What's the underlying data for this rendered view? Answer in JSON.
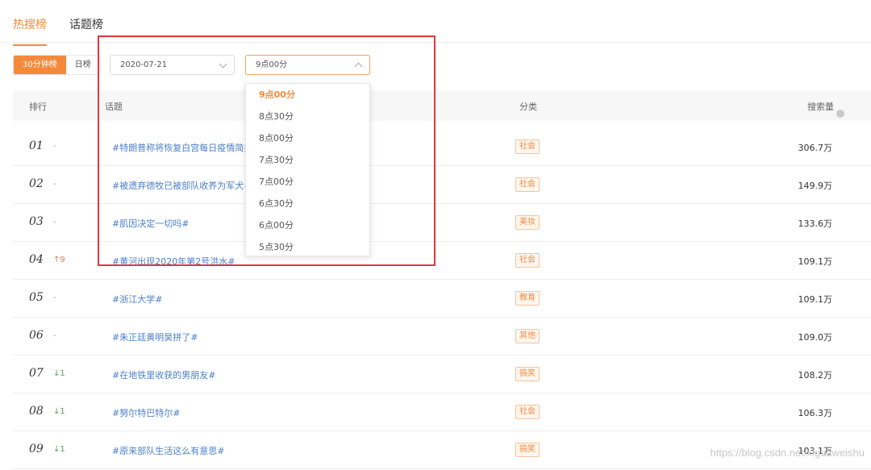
{
  "tabs": [
    {
      "label": "热搜榜",
      "active": true
    },
    {
      "label": "话题榜",
      "active": false
    }
  ],
  "filters": {
    "period_buttons": [
      {
        "label": "30分钟榜",
        "active": true
      },
      {
        "label": "日榜",
        "active": false
      }
    ],
    "date_value": "2020-07-21",
    "time_value": "9点00分"
  },
  "dropdown": {
    "options": [
      "9点00分",
      "8点30分",
      "8点00分",
      "7点30分",
      "7点00分",
      "6点30分",
      "6点00分",
      "5点30分"
    ],
    "selected": "9点00分"
  },
  "table": {
    "headers": {
      "rank": "排行",
      "topic": "话题",
      "category": "分类",
      "volume": "搜索量"
    },
    "rows": [
      {
        "rank": "01",
        "trend": "-",
        "trend_dir": "none",
        "topic": "#特朗普称将恢复白宫每日疫情简报#",
        "category": "社会",
        "volume": "306.7万"
      },
      {
        "rank": "02",
        "trend": "-",
        "trend_dir": "none",
        "topic": "#被遗弃德牧已被部队收养为军犬#",
        "category": "社会",
        "volume": "149.9万"
      },
      {
        "rank": "03",
        "trend": "-",
        "trend_dir": "none",
        "topic": "#肌因决定一切吗#",
        "category": "美妆",
        "volume": "133.6万"
      },
      {
        "rank": "04",
        "trend": "↑9",
        "trend_dir": "up",
        "topic": "#黄河出现2020年第2号洪水#",
        "category": "社会",
        "volume": "109.1万"
      },
      {
        "rank": "05",
        "trend": "-",
        "trend_dir": "none",
        "topic": "#浙江大学#",
        "category": "教育",
        "volume": "109.1万"
      },
      {
        "rank": "06",
        "trend": "-",
        "trend_dir": "none",
        "topic": "#朱正廷黄明昊拼了#",
        "category": "其他",
        "volume": "109.0万"
      },
      {
        "rank": "07",
        "trend": "↓1",
        "trend_dir": "down",
        "topic": "#在地铁里收获的男朋友#",
        "category": "搞笑",
        "volume": "108.2万"
      },
      {
        "rank": "08",
        "trend": "↓1",
        "trend_dir": "down",
        "topic": "#努尔特巴特尔#",
        "category": "社会",
        "volume": "106.3万"
      },
      {
        "rank": "09",
        "trend": "↓1",
        "trend_dir": "down",
        "topic": "#原来部队生活这么有意思#",
        "category": "搞笑",
        "volume": "103.1万"
      }
    ]
  },
  "watermark": "https://blog.csdn.net/xiguaweishu",
  "colors": {
    "accent": "#f5893b",
    "highlight_box": "#e0383e",
    "link": "#4a7fc8"
  }
}
